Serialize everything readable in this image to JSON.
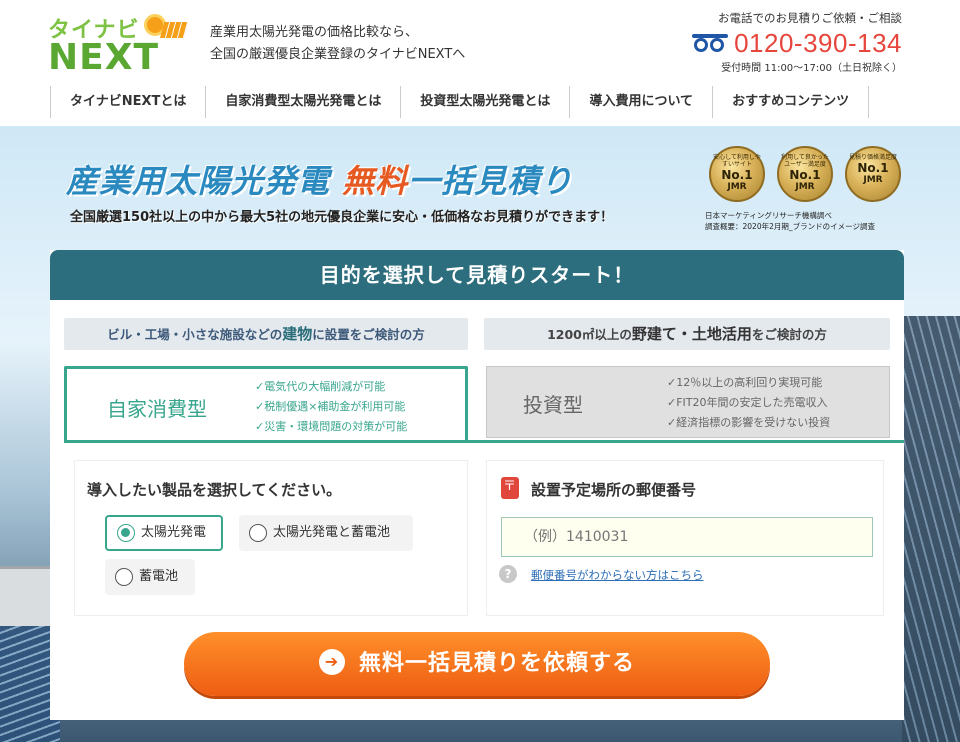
{
  "header": {
    "logo_top": "タイナビ",
    "logo_bottom": "NEXT",
    "tagline_1": "産業用太陽光発電の価格比較なら、",
    "tagline_2": "全国の厳選優良企業登録のタイナビNEXTへ",
    "phone_note": "お電話でのお見積りご依頼・ご相談",
    "phone_number": "0120-390-134",
    "phone_hours": "受付時間 11:00〜17:00（土日祝除く）"
  },
  "nav": [
    "タイナビNEXTとは",
    "自家消費型太陽光発電とは",
    "投資型太陽光発電とは",
    "導入費用について",
    "おすすめコンテンツ"
  ],
  "hero": {
    "title_a": "産業用太陽光発電",
    "title_free": "無料",
    "title_b": "一括見積り",
    "subtitle": "全国厳選150社以上の中から最大5社の地元優良企業に安心・低価格なお見積りができます！",
    "awards": [
      {
        "top": "安心して利用しやすいサイト",
        "rank": "No.1",
        "mark": "JMR"
      },
      {
        "top": "利用して良かったユーザー満足度",
        "rank": "No.1",
        "mark": "JMR"
      },
      {
        "top": "見積り価格満足度",
        "rank": "No.1",
        "mark": "JMR"
      }
    ],
    "awards_note_1": "日本マーケティングリサーチ機構調べ",
    "awards_note_2": "調査概要：2020年2月期_ブランドのイメージ調査"
  },
  "form": {
    "heading": "目的を選択して見積りスタート！",
    "target_left_a": "ビル・工場・小さな施設などの",
    "target_left_em": "建物",
    "target_left_b": "に設置をご検討の方",
    "target_right_a": "1200㎡以上の",
    "target_right_em": "野建て・土地活用",
    "target_right_b": "をご検討の方",
    "tab_self": {
      "name": "自家消費型",
      "points": [
        "✓電気代の大幅削減が可能",
        "✓税制優遇×補助金が利用可能",
        "✓災害・環境問題の対策が可能"
      ]
    },
    "tab_invest": {
      "name": "投資型",
      "points": [
        "✓12％以上の高利回り実現可能",
        "✓FIT20年間の安定した売電収入",
        "✓経済指標の影響を受けない投資"
      ]
    },
    "product_title": "導入したい製品を選択してください。",
    "options": [
      "太陽光発電",
      "太陽光発電と蓄電池",
      "蓄電池"
    ],
    "selected_option": "太陽光発電",
    "zip_title": "設置予定場所の郵便番号",
    "zip_placeholder": "（例）1410031",
    "zip_help": "郵便番号がわからない方はこちら",
    "submit": "無料一括見積りを依頼する"
  },
  "colors": {
    "brand_green": "#38a68d",
    "header_teal": "#2c6e7d",
    "cta_orange": "#ee5d12",
    "phone_red": "#e7463c"
  }
}
